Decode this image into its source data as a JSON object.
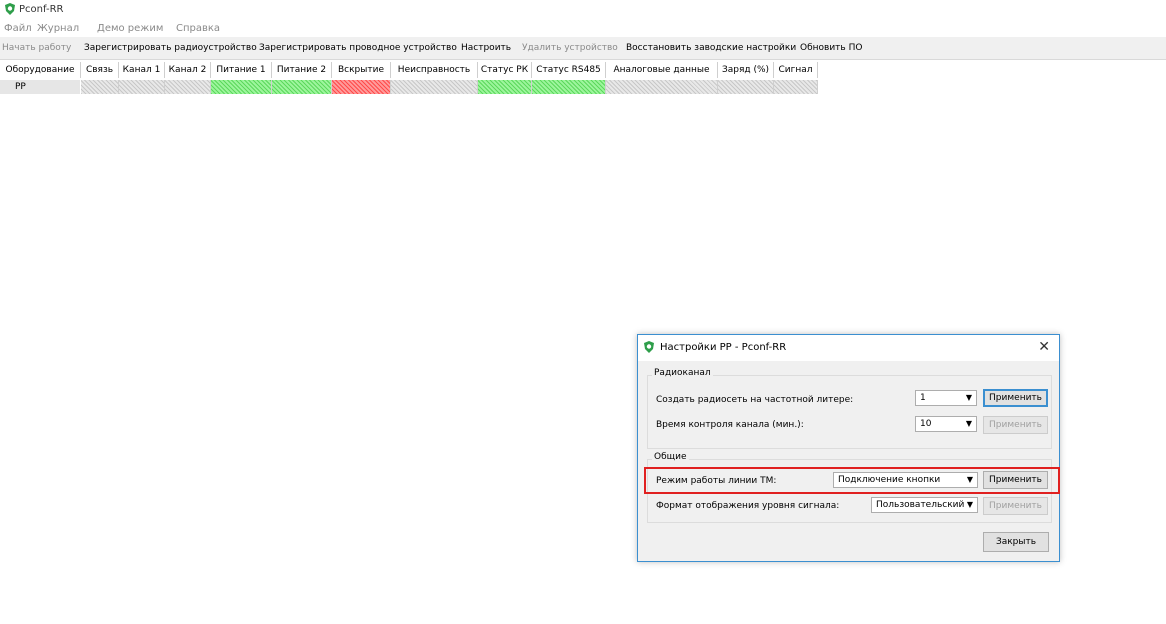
{
  "app": {
    "title": "Pconf-RR"
  },
  "menu": [
    "Файл",
    "Журнал",
    "Демо режим",
    "Справка"
  ],
  "toolbar": [
    {
      "label": "Начать работу",
      "enabled": false
    },
    {
      "label": "Зарегистрировать радиоустройство",
      "enabled": true
    },
    {
      "label": "Зарегистрировать проводное устройство",
      "enabled": true
    },
    {
      "label": "Настроить",
      "enabled": true
    },
    {
      "label": "Удалить устройство",
      "enabled": false
    },
    {
      "label": "Восстановить заводские настройки",
      "enabled": true
    },
    {
      "label": "Обновить ПО",
      "enabled": true
    }
  ],
  "table": {
    "headers": [
      "Оборудование",
      "Связь",
      "Канал 1",
      "Канал 2",
      "Питание 1",
      "Питание 2",
      "Вскрытие",
      "Неисправность",
      "Статус РК",
      "Статус RS485",
      "Аналоговые данные",
      "Заряд (%)",
      "Сигнал"
    ],
    "rows": [
      {
        "device": "РР",
        "states": [
          "grey",
          "grey",
          "grey",
          "green",
          "green",
          "red",
          "grey",
          "green",
          "green",
          "grey",
          "grey",
          "grey"
        ]
      }
    ]
  },
  "dialog": {
    "title": "Настройки РР - Pconf-RR",
    "close_icon": "close-icon",
    "radio_group": {
      "label": "Радиоканал",
      "freq_label": "Создать радиосеть на частотной литере:",
      "freq_value": "1",
      "freq_apply": "Применить",
      "control_label": "Время контроля канала (мин.):",
      "control_value": "10",
      "control_apply": "Применить"
    },
    "common_group": {
      "label": "Общие",
      "tm_label": "Режим работы линии ТМ:",
      "tm_value": "Подключение кнопки",
      "tm_apply": "Применить",
      "signal_label": "Формат отображения уровня сигнала:",
      "signal_value": "Пользовательский",
      "signal_apply": "Применить"
    },
    "close_button": "Закрыть"
  },
  "colors": {
    "accent": "#3b8fd0",
    "highlight": "#e02020",
    "ok": "#5cd85c",
    "alarm": "#ff4a4a"
  }
}
